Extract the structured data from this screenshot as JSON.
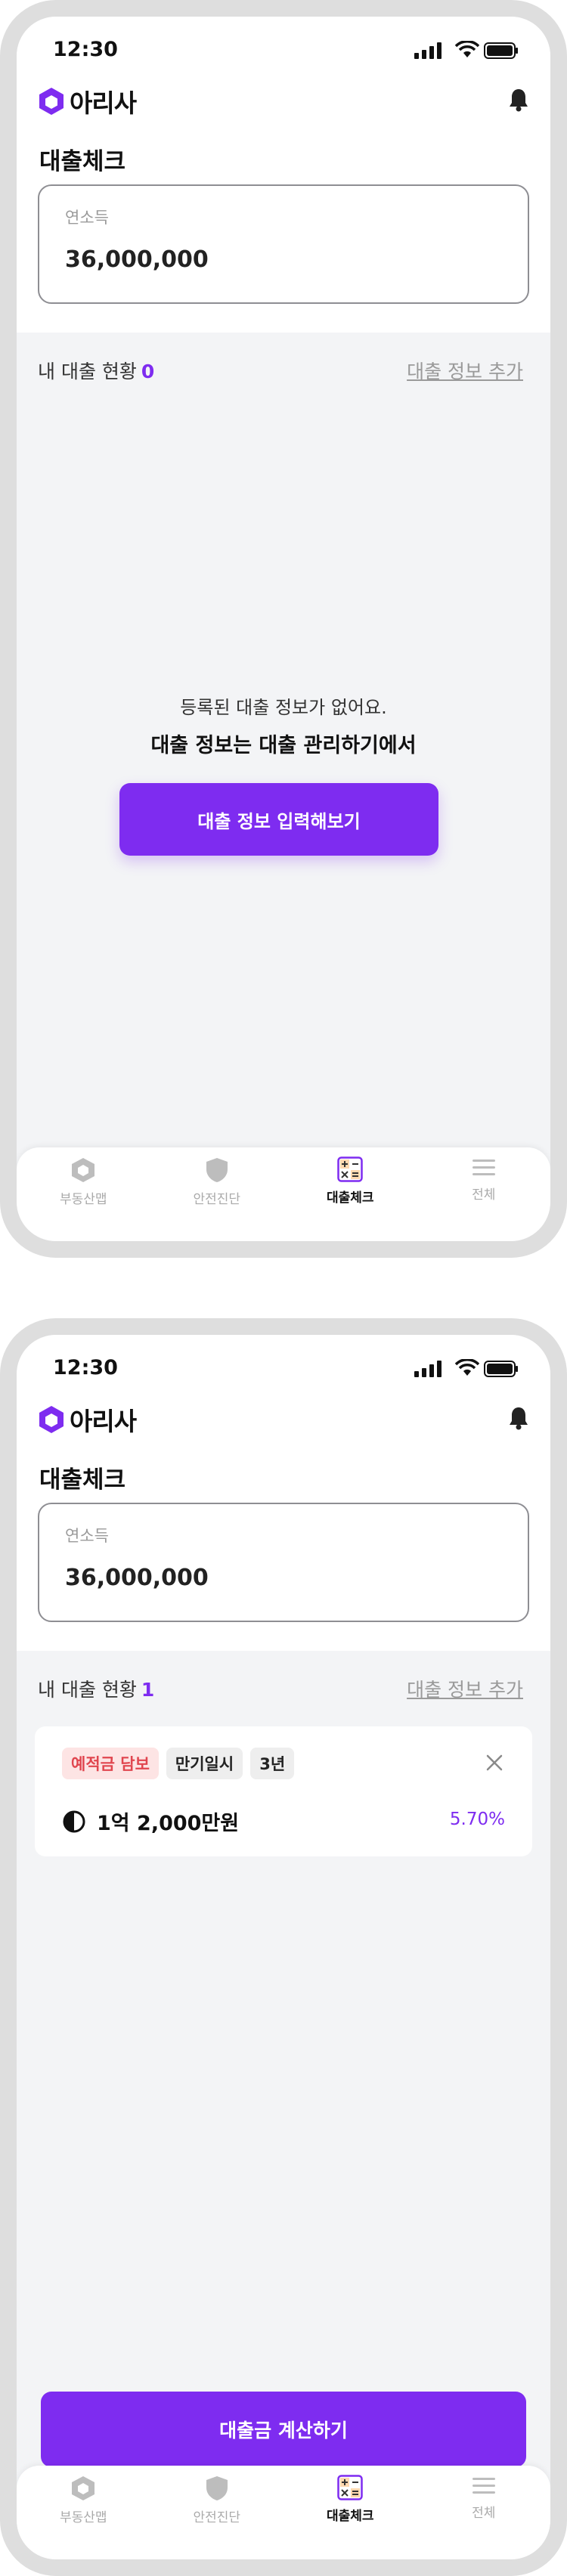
{
  "status": {
    "time": "12:30"
  },
  "brand": {
    "name": "아리사",
    "accent": "#7e2cf0"
  },
  "page": {
    "title": "대출체크"
  },
  "income": {
    "label": "연소득",
    "value": "36,000,000"
  },
  "section": {
    "title": "내 대출 현황",
    "count_empty": "0",
    "count_filled": "1",
    "add_link": "대출 정보 추가"
  },
  "empty": {
    "line1": "등록된 대출 정보가 없어요.",
    "line2": "대출 정보는 대출 관리하기에서",
    "cta": "대출 정보 입력해보기"
  },
  "loan": {
    "chips": [
      "예적금 담보",
      "만기일시",
      "3년"
    ],
    "amount": "1억 2,000만원",
    "rate": "5.70%"
  },
  "cta_calc": "대출금 계산하기",
  "tabs": [
    {
      "label": "부동산맵",
      "icon": "cube-icon"
    },
    {
      "label": "안전진단",
      "icon": "shield-icon"
    },
    {
      "label": "대출체크",
      "icon": "calculator-icon"
    },
    {
      "label": "전체",
      "icon": "menu-icon"
    }
  ]
}
